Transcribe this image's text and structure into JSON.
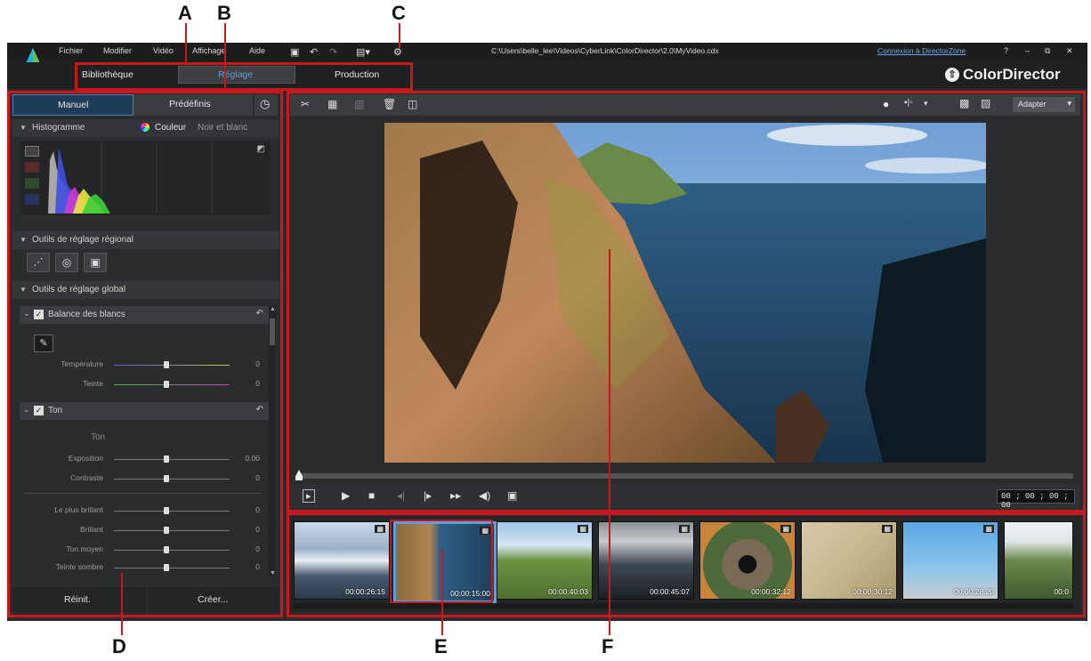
{
  "callouts": {
    "a": "A",
    "b": "B",
    "c": "C",
    "d": "D",
    "e": "E",
    "f": "F"
  },
  "menu": [
    "Fichier",
    "Modifier",
    "Vidéo",
    "Affichage",
    "Aide"
  ],
  "file_path": "C:\\Users\\belle_lee\\Videos\\CyberLink\\ColorDirector\\2.0\\MyVideo.cdx",
  "director_zone": "Connexion à DirectorZone",
  "window_controls": {
    "help": "?",
    "min": "–",
    "restore": "⧉",
    "close": "✕"
  },
  "modes": {
    "library": "Bibliothèque",
    "adjust": "Réglage",
    "production": "Production"
  },
  "brand": "ColorDirector",
  "left_panel": {
    "tab_manual": "Manuel",
    "tab_presets": "Prédéfinis",
    "histogram_title": "Histogramme",
    "histogram_color": "Couleur",
    "histogram_bw": "Noir et blanc",
    "regional_title": "Outils de réglage régional",
    "global_title": "Outils de réglage global",
    "white_balance": "Balance des blancs",
    "temperature": {
      "label": "Température",
      "value": "0",
      "level": 0.45
    },
    "tint": {
      "label": "Teinte",
      "value": "0",
      "level": 0.45
    },
    "tone_section": "Ton",
    "tone_subtitle": "Ton",
    "exposure": {
      "label": "Exposition",
      "value": "0.00",
      "level": 0.45
    },
    "contrast": {
      "label": "Contraste",
      "value": "0",
      "level": 0.45
    },
    "brightest": {
      "label": "Le plus brillant",
      "value": "0",
      "level": 0.45
    },
    "bright": {
      "label": "Brillant",
      "value": "0",
      "level": 0.45
    },
    "midtone": {
      "label": "Ton moyen",
      "value": "0",
      "level": 0.45
    },
    "dark": {
      "label": "Teinte sombre",
      "value": "0",
      "level": 0.45
    },
    "reset": "Réinit.",
    "create": "Créer..."
  },
  "preview": {
    "fit_label": "Adapter",
    "timecode": "00 ; 00 ; 00 ; 00"
  },
  "filmstrip": [
    {
      "tc": "00:00:26:15"
    },
    {
      "tc": "00:00:15:00"
    },
    {
      "tc": "00:00:40:03"
    },
    {
      "tc": "00:00:45:07"
    },
    {
      "tc": "00:00:32:12"
    },
    {
      "tc": "00:00:30:12"
    },
    {
      "tc": "00:00:28:20"
    },
    {
      "tc": "00:0"
    }
  ],
  "colors": {
    "accent": "#5aa0e0",
    "callout_red": "#c8181c",
    "panel": "#2b2c2e"
  }
}
